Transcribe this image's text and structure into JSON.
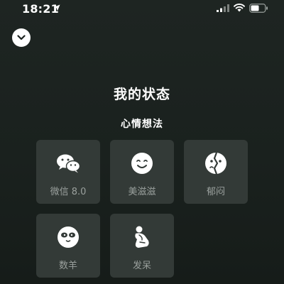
{
  "status_bar": {
    "time": "18:21",
    "icons": [
      "location-arrow-icon",
      "cellular-signal-icon",
      "wifi-icon",
      "battery-icon"
    ]
  },
  "header": {
    "collapse_icon": "chevron-down-icon"
  },
  "page": {
    "title": "我的状态",
    "section_title": "心情想法"
  },
  "statuses": [
    {
      "label": "微信 8.0",
      "icon": "wechat-icon"
    },
    {
      "label": "美滋滋",
      "icon": "smile-face-icon"
    },
    {
      "label": "郁闷",
      "icon": "split-face-icon"
    },
    {
      "label": "数羊",
      "icon": "sheep-face-icon"
    },
    {
      "label": "发呆",
      "icon": "daze-figure-icon"
    }
  ],
  "colors": {
    "background": "#1c2320",
    "card": "#333a37",
    "label": "#9aa09d",
    "icon": "#ffffff"
  }
}
